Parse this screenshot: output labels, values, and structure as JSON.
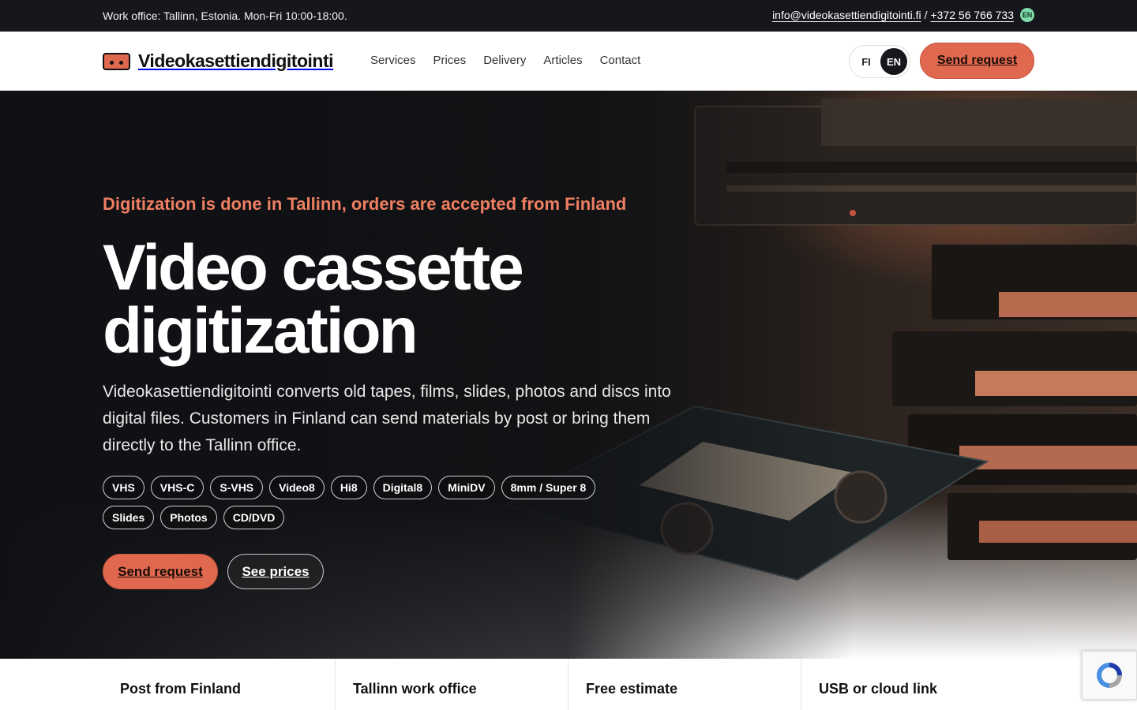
{
  "topbar": {
    "office": "Work office: Tallinn, Estonia. Mon-Fri 10:00-18:00.",
    "email": "info@videokasettiendigitointi.fi",
    "separator": "/",
    "phone": "+372 56 766 733",
    "lang_badge": "EN"
  },
  "header": {
    "logo_text": "Videokasettiendigitointi",
    "nav": [
      "Services",
      "Prices",
      "Delivery",
      "Articles",
      "Contact"
    ],
    "lang": {
      "fi": "FI",
      "en": "EN"
    },
    "cta": "Send request"
  },
  "hero": {
    "eyebrow": "Digitization is done in Tallinn, orders are accepted from Finland",
    "title_line1": "Video cassette",
    "title_line2": "digitization",
    "lead": "Videokasettiendigitointi converts old tapes, films, slides, photos and discs into digital files. Customers in Finland can send materials by post or bring them directly to the Tallinn office.",
    "chips": [
      "VHS",
      "VHS-C",
      "S-VHS",
      "Video8",
      "Hi8",
      "Digital8",
      "MiniDV",
      "8mm / Super 8",
      "Slides",
      "Photos",
      "CD/DVD"
    ],
    "primary_button": "Send request",
    "secondary_button": "See prices"
  },
  "features": [
    "Post from Finland",
    "Tallinn work office",
    "Free estimate",
    "USB or cloud link"
  ],
  "colors": {
    "accent": "#e0684e",
    "eyebrow": "#ef7f62",
    "dark": "#15171c"
  },
  "icons": {
    "logo": "cassette-icon",
    "recaptcha": "recaptcha-icon"
  }
}
